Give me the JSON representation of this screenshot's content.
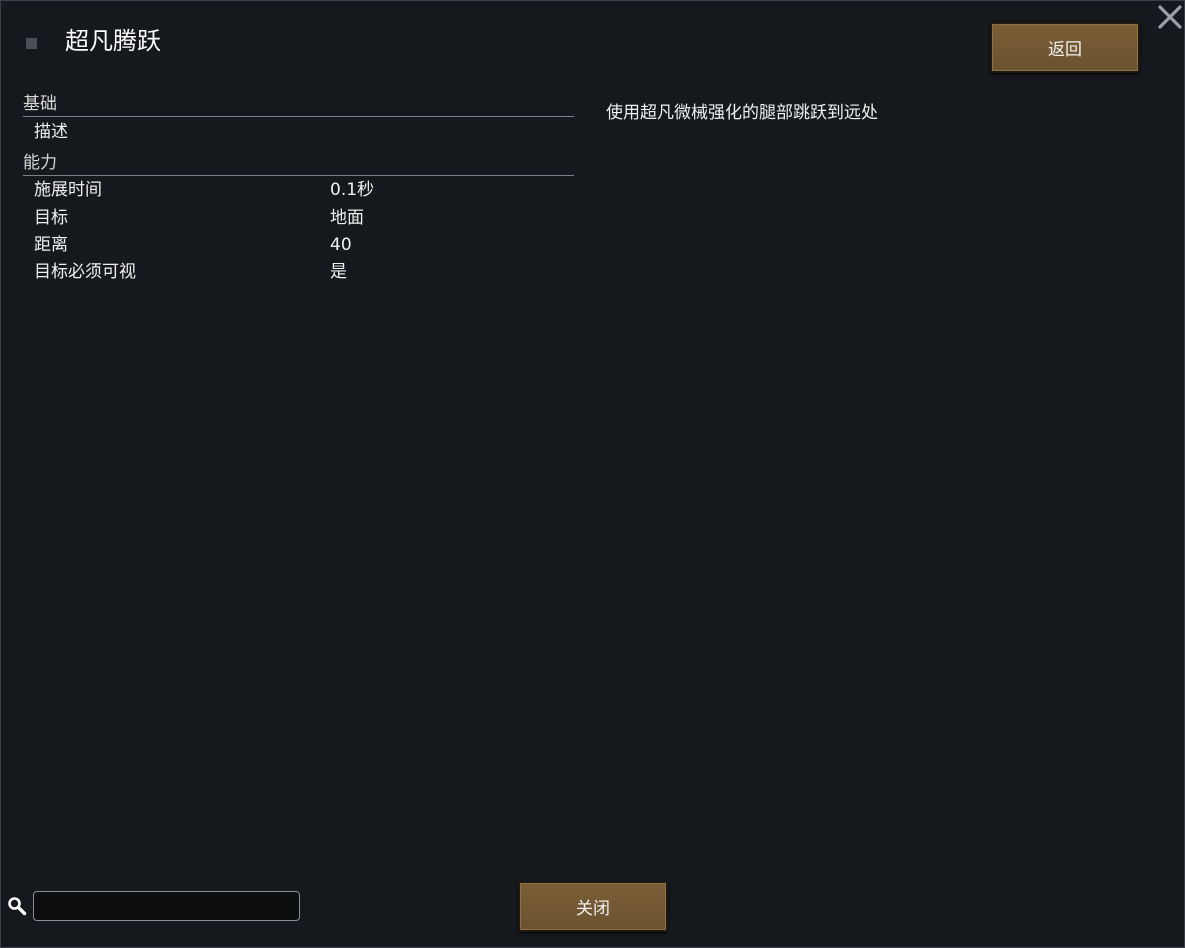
{
  "window": {
    "title": "超凡腾跃",
    "back_label": "返回",
    "close_label": "关闭"
  },
  "sections": [
    {
      "header": "基础",
      "rows": [
        {
          "label": "描述",
          "value": ""
        }
      ]
    },
    {
      "header": "能力",
      "rows": [
        {
          "label": "施展时间",
          "value": "0.1秒"
        },
        {
          "label": "目标",
          "value": "地面"
        },
        {
          "label": "距离",
          "value": "40"
        },
        {
          "label": "目标必须可视",
          "value": "是"
        }
      ]
    }
  ],
  "description": "使用超凡微械强化的腿部跳跃到远处",
  "search": {
    "value": "",
    "placeholder": ""
  },
  "icons": {
    "close": "close-icon",
    "search": "search-icon",
    "title": "ability-icon"
  },
  "colors": {
    "background": "#15191d",
    "button": "#6f5532"
  }
}
